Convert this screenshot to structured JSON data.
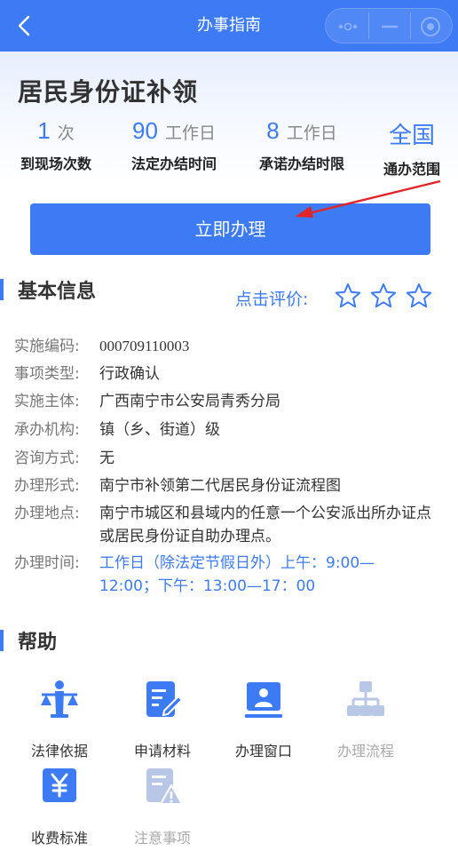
{
  "header": {
    "title": "办事指南"
  },
  "service": {
    "title": "居民身份证补领"
  },
  "stats": [
    {
      "value": "1",
      "unit": "次",
      "label": "到现场次数"
    },
    {
      "value": "90",
      "unit": "工作日",
      "label": "法定办结时间"
    },
    {
      "value": "8",
      "unit": "工作日",
      "label": "承诺办结时限"
    },
    {
      "value": "全国",
      "unit": "",
      "label": "通办范围"
    }
  ],
  "action": {
    "label": "立即办理"
  },
  "basic_info": {
    "title": "基本信息",
    "rating_label": "点击评价:",
    "rows": [
      {
        "key": "实施编码:",
        "value": "000709110003"
      },
      {
        "key": "事项类型:",
        "value": "行政确认"
      },
      {
        "key": "实施主体:",
        "value": "广西南宁市公安局青秀分局"
      },
      {
        "key": "承办机构:",
        "value": "镇（乡、街道）级"
      },
      {
        "key": "咨询方式:",
        "value": "无"
      },
      {
        "key": "办理形式:",
        "value": "南宁市补领第二代居民身份证流程图"
      },
      {
        "key": "办理地点:",
        "value": "南宁市城区和县域内的任意一个公安派出所办证点或居民身份证自助办理点。"
      },
      {
        "key": "办理时间:",
        "value": "工作日（除法定节假日外）上午：9:00—12:00；下午：13:00—17：00"
      }
    ]
  },
  "help": {
    "title": "帮助",
    "items": [
      {
        "label": "法律依据",
        "icon": "scales-icon"
      },
      {
        "label": "申请材料",
        "icon": "document-edit-icon"
      },
      {
        "label": "办理窗口",
        "icon": "service-window-icon"
      },
      {
        "label": "办理流程",
        "icon": "flowchart-icon"
      },
      {
        "label": "收费标准",
        "icon": "yuan-icon"
      },
      {
        "label": "注意事项",
        "icon": "warning-document-icon"
      }
    ]
  },
  "colors": {
    "primary": "#3d7bf5",
    "annotation_arrow": "#e0262a"
  }
}
